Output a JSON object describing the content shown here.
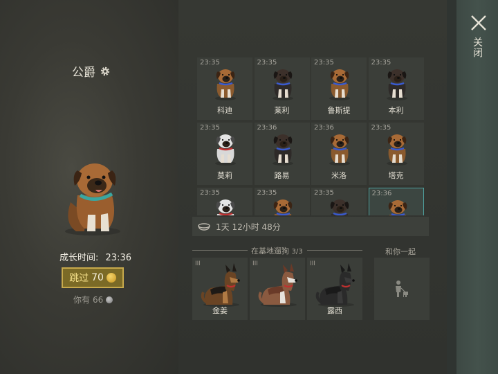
{
  "pet": {
    "name": "公爵",
    "growth_label": "成长时间:",
    "growth_time": "23:36",
    "skip_label": "跳过",
    "skip_cost": "70",
    "have_label": "你有",
    "have_amount": "66"
  },
  "puppies": [
    {
      "time": "23:35",
      "name": "科迪",
      "coat": "tan"
    },
    {
      "time": "23:35",
      "name": "莱利",
      "coat": "dark"
    },
    {
      "time": "23:35",
      "name": "鲁斯提",
      "coat": "tan"
    },
    {
      "time": "23:35",
      "name": "本利",
      "coat": "dark"
    },
    {
      "time": "23:35",
      "name": "莫莉",
      "coat": "husky"
    },
    {
      "time": "23:36",
      "name": "路易",
      "coat": "dark"
    },
    {
      "time": "23:36",
      "name": "米洛",
      "coat": "tan"
    },
    {
      "time": "23:35",
      "name": "塔克",
      "coat": "tan"
    },
    {
      "time": "23:35",
      "name": "",
      "coat": "husky"
    },
    {
      "time": "23:35",
      "name": "",
      "coat": "tan"
    },
    {
      "time": "23:35",
      "name": "",
      "coat": "dark"
    },
    {
      "time": "23:36",
      "name": "",
      "coat": "tan",
      "selected": true
    }
  ],
  "timer": {
    "text": "1天 12小时 48分"
  },
  "base": {
    "title": "在基地遛狗",
    "count": "3/3",
    "with_you": "和你一起",
    "dogs": [
      {
        "rank": "III",
        "name": "金姜",
        "coat": "shepherd"
      },
      {
        "rank": "III",
        "name": "",
        "coat": "husky"
      },
      {
        "rank": "III",
        "name": "露西",
        "coat": "black"
      }
    ]
  },
  "close": {
    "label": "关闭"
  },
  "colors": {
    "accent": "#c7a94c",
    "selected": "#4fa3a0",
    "coin": "#e0b040"
  }
}
